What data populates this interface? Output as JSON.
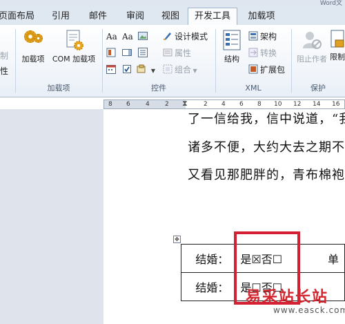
{
  "window": {
    "title_fragment": "Word文"
  },
  "tabs": [
    {
      "label": "页面布局"
    },
    {
      "label": "引用"
    },
    {
      "label": "邮件"
    },
    {
      "label": "审阅"
    },
    {
      "label": "视图"
    },
    {
      "label": "开发工具",
      "active": true
    },
    {
      "label": "加载项"
    }
  ],
  "ribbon": {
    "left_cut": {
      "item1": "制",
      "item2": "性"
    },
    "addins_group": {
      "label": "加载项",
      "addins_button": "加载项",
      "com_button": "COM 加载项"
    },
    "controls_group": {
      "label": "控件",
      "design_mode": "设计模式",
      "properties": "属性",
      "group": "组合"
    },
    "xml_group": {
      "label": "XML",
      "structure": "结构",
      "schema": "架构",
      "transform": "转换",
      "expansion_pack": "扩展包"
    },
    "protect_group": {
      "label": "保护",
      "block_authors": "阻止作者",
      "restrict": "限制"
    }
  },
  "ruler": {
    "numbers": [
      "8",
      "6",
      "4",
      "2",
      "2",
      "4",
      "6",
      "8",
      "10",
      "12",
      "14",
      "16"
    ]
  },
  "document": {
    "line1": "了一信给我，信中说道，“我",
    "line2": "诸多不便，大约大去之期不远",
    "line3": "又看见那肥胖的，青布棉袍，",
    "table": {
      "row1": {
        "label": "结婚：",
        "options": "是☒否☐",
        "next": "单"
      },
      "row2": {
        "label": "结婚：",
        "options": "是☐否☐",
        "next": ""
      }
    }
  },
  "watermark": {
    "text": "易采站长站",
    "url": "www.easck.com"
  },
  "colors": {
    "highlight_box": "#d42033",
    "watermark_red": "#d4262f",
    "ribbon_tab_bg": "#dfe7f1"
  }
}
